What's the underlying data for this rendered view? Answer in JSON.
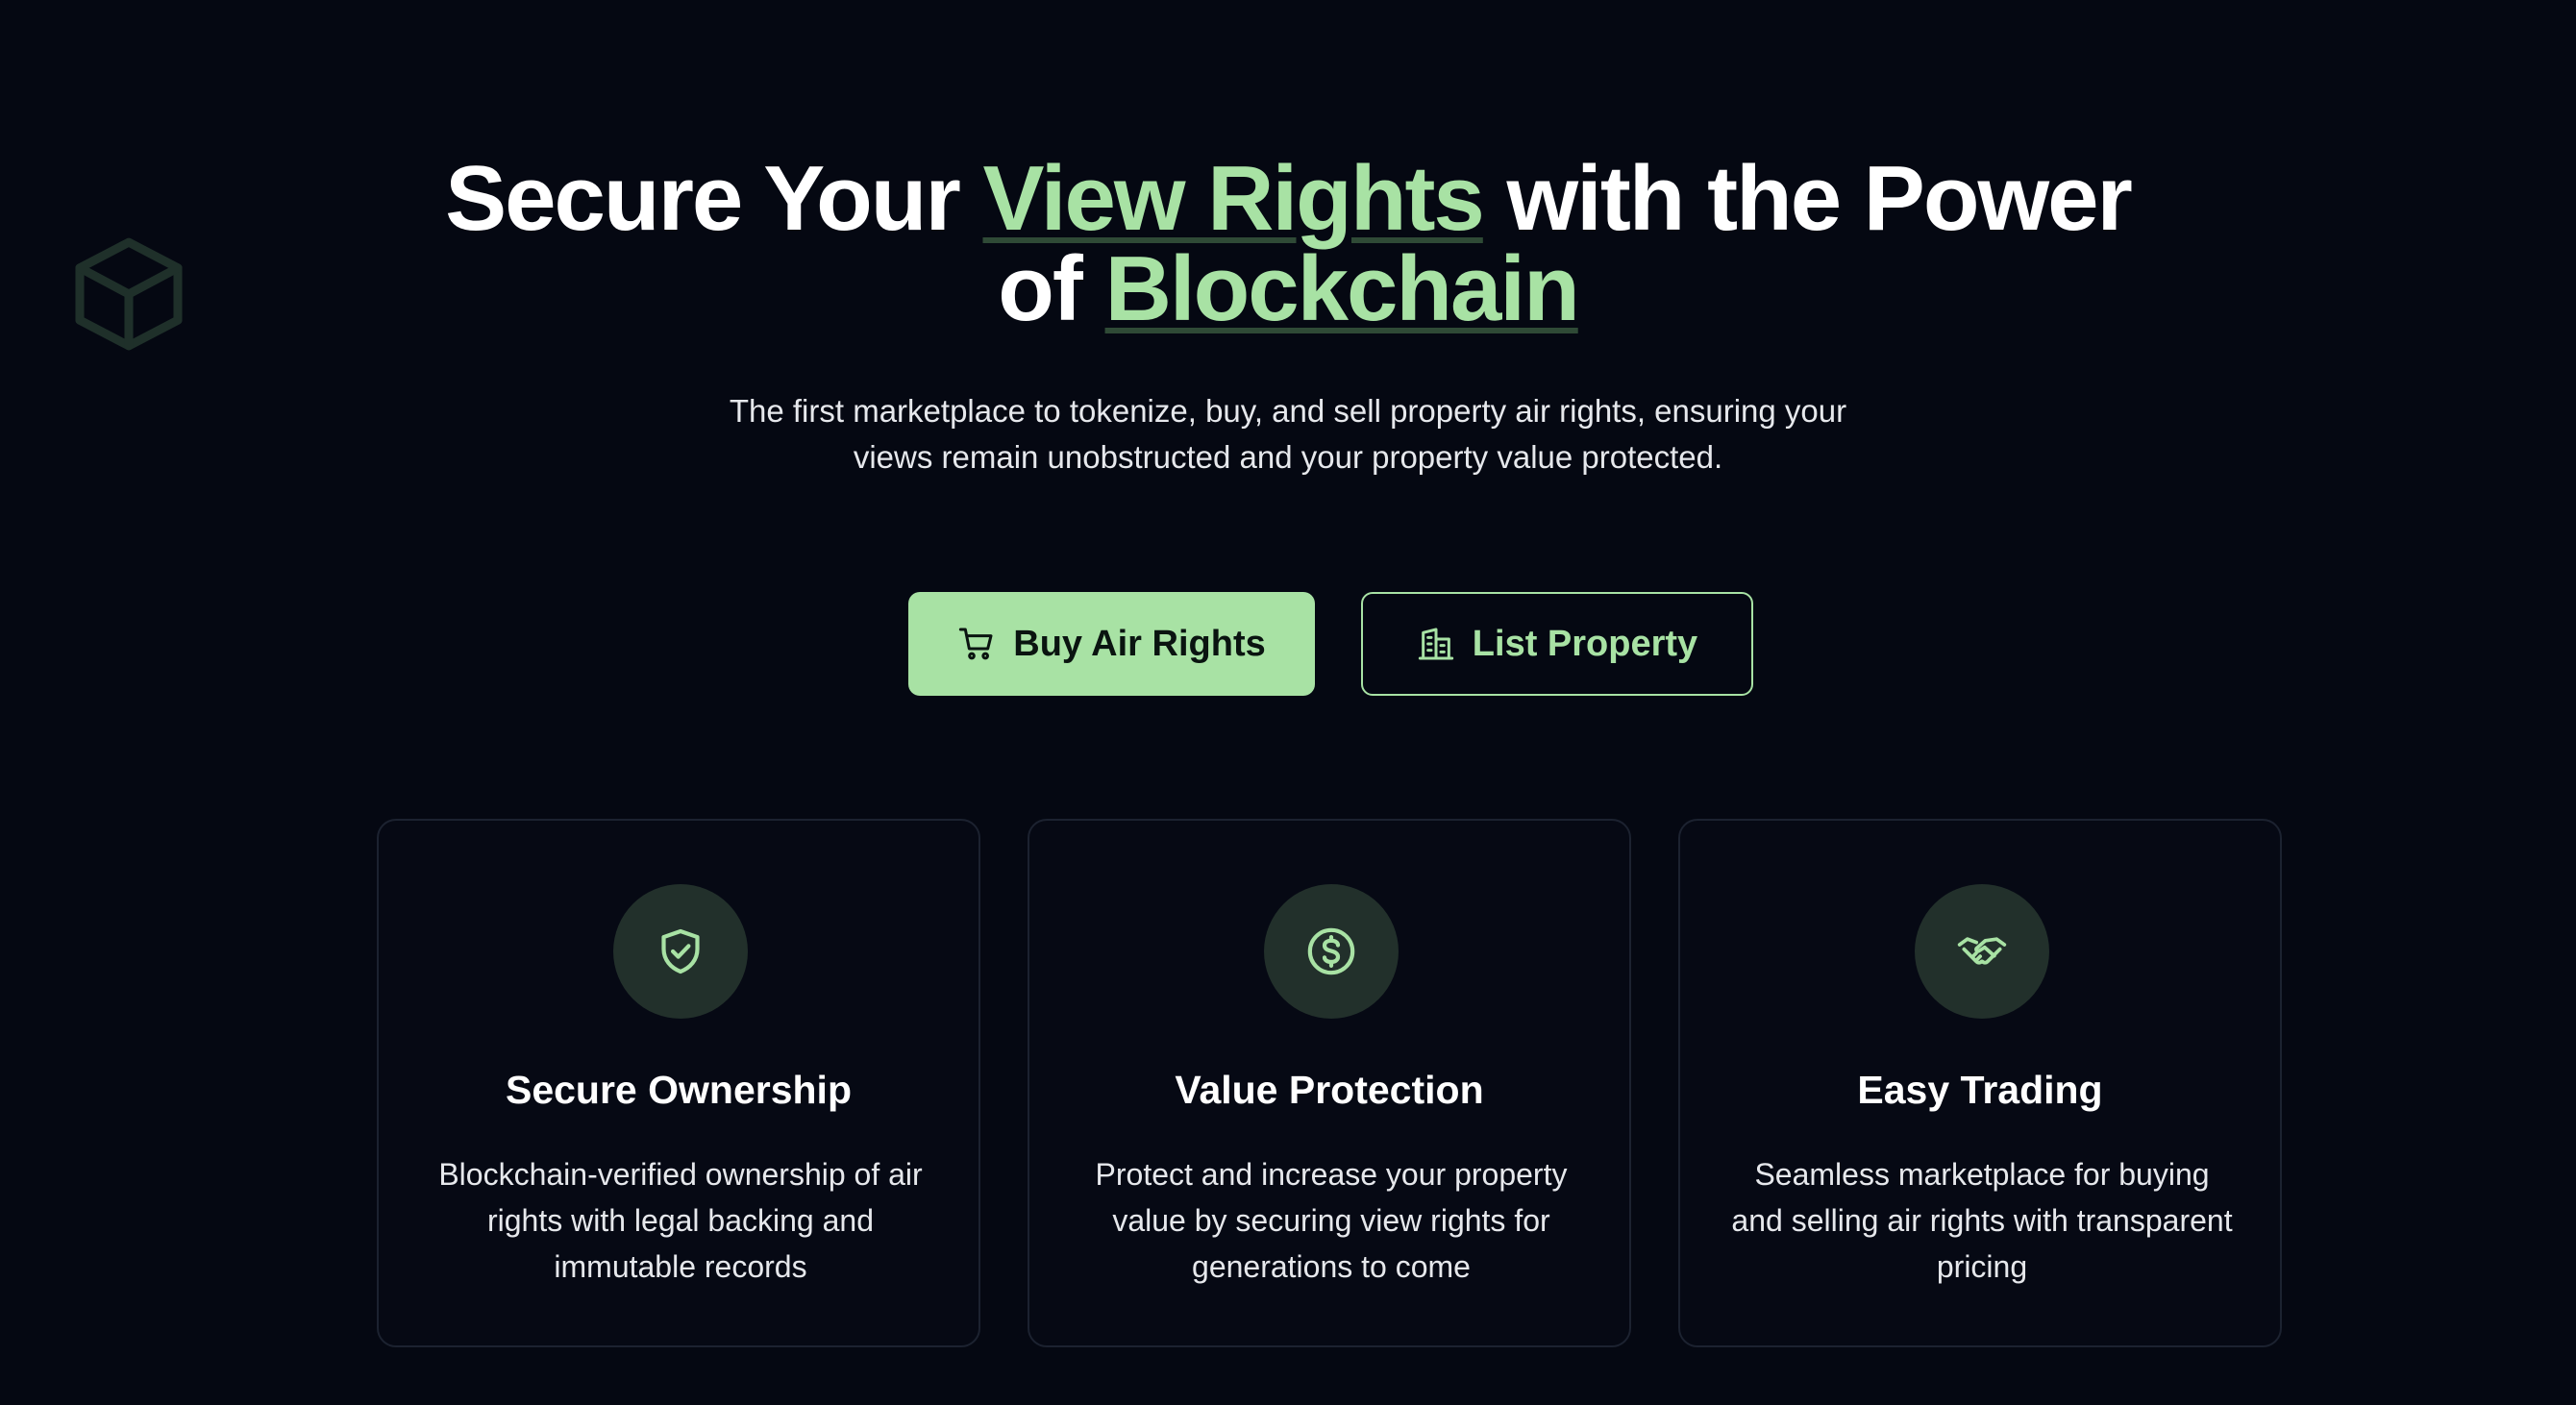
{
  "hero": {
    "title_part1": "Secure Your ",
    "title_accent1": "View Rights",
    "title_part2": " with the Power",
    "title_part3": "of ",
    "title_accent2": "Blockchain",
    "subtitle": "The first marketplace to tokenize, buy, and sell property air rights, ensuring your views remain unobstructed and your property value protected."
  },
  "actions": {
    "buy_label": "Buy Air Rights",
    "buy_icon": "shopping-cart-icon",
    "list_label": "List Property",
    "list_icon": "building-icon"
  },
  "features": [
    {
      "icon": "shield-check-icon",
      "title": "Secure Ownership",
      "description": "Blockchain-verified ownership of air rights with legal backing and immutable records"
    },
    {
      "icon": "dollar-circle-icon",
      "title": "Value Protection",
      "description": "Protect and increase your property value by securing view rights for generations to come"
    },
    {
      "icon": "handshake-icon",
      "title": "Easy Trading",
      "description": "Seamless marketplace for buying and selling air rights with transparent pricing"
    }
  ],
  "decor": {
    "icon": "cube-icon"
  },
  "colors": {
    "background": "#050812",
    "accent": "#a8e2a4",
    "icon_circle": "#22302b",
    "card_border": "#1c2230",
    "text": "#ffffff"
  }
}
